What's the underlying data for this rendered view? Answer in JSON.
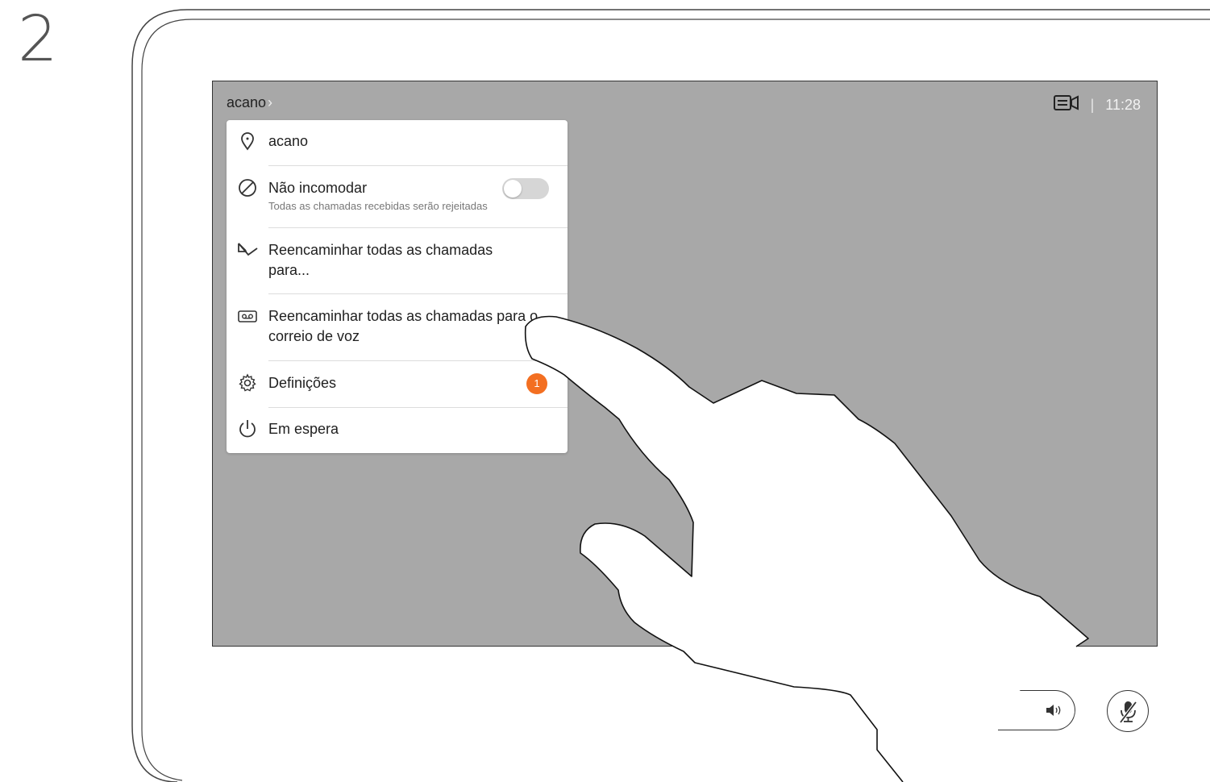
{
  "step": {
    "number": "2"
  },
  "status_bar": {
    "breadcrumb": "acano",
    "breadcrumb_chevron": "›",
    "time": "11:28",
    "separator": "|",
    "camera_icon": "camera-selfview-icon"
  },
  "menu": {
    "items": [
      {
        "icon": "location-pin-icon",
        "label": "acano"
      },
      {
        "icon": "do-not-disturb-icon",
        "label": "Não incomodar",
        "sublabel": "Todas as chamadas recebidas serão rejeitadas",
        "toggle_on": false
      },
      {
        "icon": "call-forward-icon",
        "label": "Reencaminhar todas as chamadas para..."
      },
      {
        "icon": "voicemail-icon",
        "label": "Reencaminhar todas as chamadas para o correio de voz"
      },
      {
        "icon": "gear-icon",
        "label": "Definições",
        "badge": "1"
      },
      {
        "icon": "power-icon",
        "label": "Em espera"
      }
    ]
  },
  "controls": {
    "volume_icon": "speaker-icon",
    "mute_icon": "microphone-muted-icon"
  },
  "colors": {
    "screen_bg": "#a8a8a8",
    "badge": "#f36f21",
    "toggle_off": "#d6d6d6"
  }
}
